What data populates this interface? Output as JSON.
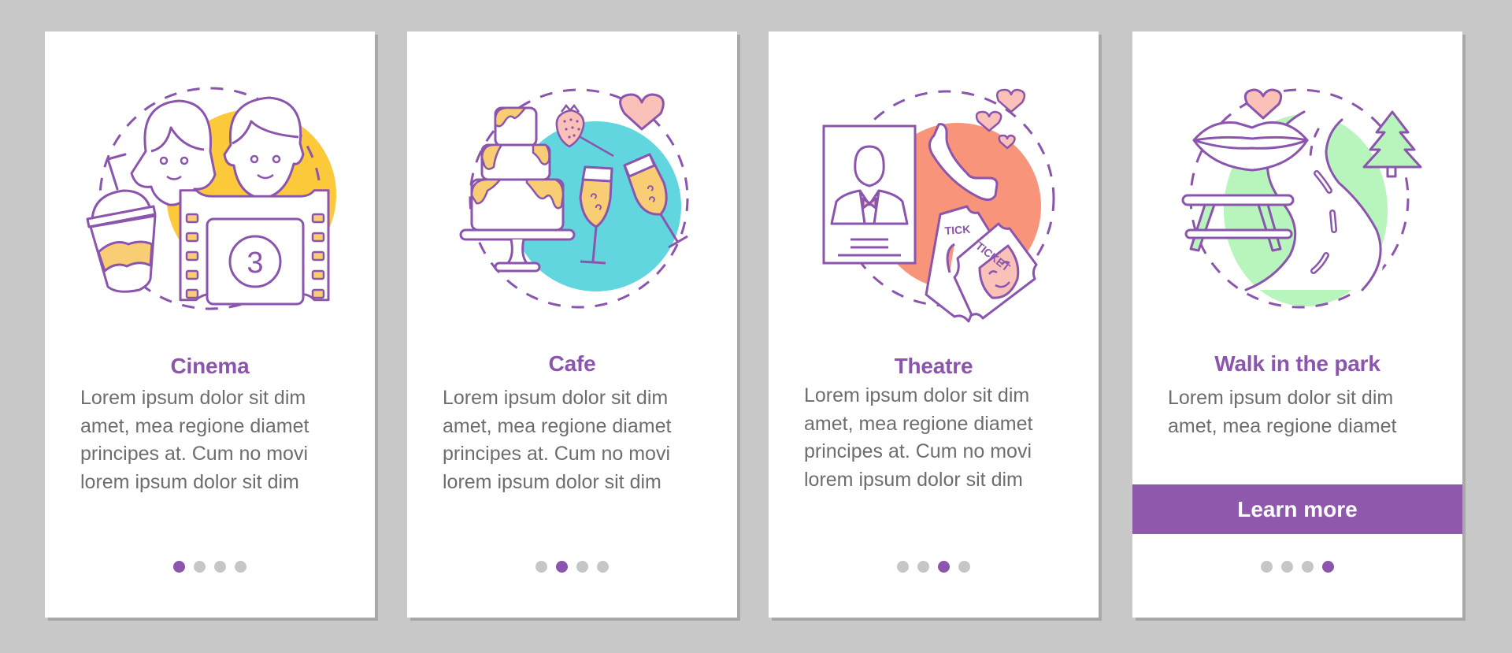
{
  "colors": {
    "background": "#c8c8c8",
    "card": "#ffffff",
    "accent": "#8b55ad",
    "body_text": "#6d6d6d",
    "dot_inactive": "#c6c6c6",
    "cinema_blob": "#fcc93b",
    "cafe_blob": "#62d6df",
    "theatre_blob": "#f8947a",
    "park_blob": "#b8f5bd",
    "pink": "#f9c1b8",
    "peach": "#f8cd74"
  },
  "cards": [
    {
      "title": "Cinema",
      "illustration": "cinema-illustration",
      "body_lines": [
        "Lorem ipsum dolor sit dim",
        "amet, mea regione diamet",
        "principes at. Cum no movi",
        "lorem ipsum dolor sit dim"
      ],
      "active_page": 1,
      "film_number": "3"
    },
    {
      "title": "Cafe",
      "illustration": "cafe-illustration",
      "body_lines": [
        "Lorem ipsum dolor sit dim",
        "amet, mea regione diamet",
        "principes at. Cum no movi",
        "lorem ipsum dolor sit dim"
      ],
      "active_page": 2
    },
    {
      "title": "Theatre",
      "illustration": "theatre-illustration",
      "body_lines": [
        "Lorem ipsum dolor sit dim",
        "amet, mea regione diamet",
        "principes at. Cum no movi",
        "lorem ipsum dolor sit dim"
      ],
      "active_page": 3,
      "ticket_front": "TICKET",
      "ticket_back": "TICK"
    },
    {
      "title": "Walk in the park",
      "illustration": "park-illustration",
      "body_lines": [
        "Lorem ipsum dolor sit dim",
        "amet, mea regione diamet"
      ],
      "active_page": 4,
      "cta_label": "Learn more"
    }
  ],
  "pagination": {
    "total_pages": 4
  }
}
